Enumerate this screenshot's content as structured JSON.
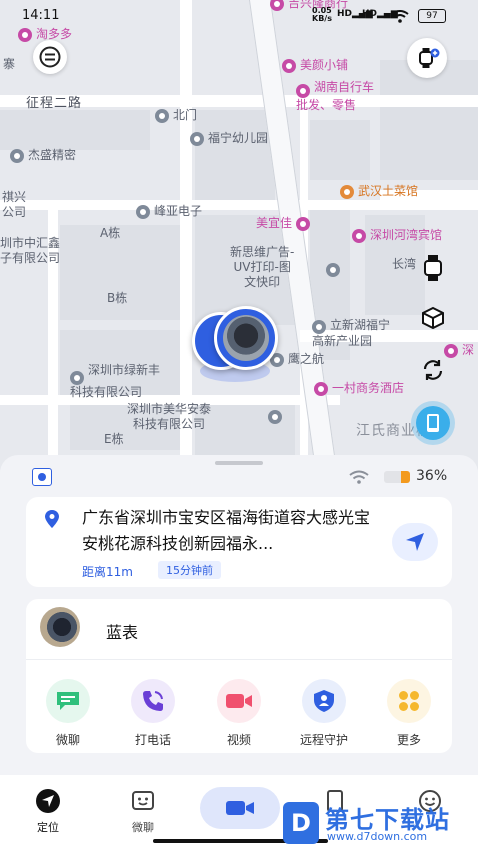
{
  "status_bar": {
    "time": "14:11",
    "net_speed_top": "0.05",
    "net_speed_unit": "KB/s",
    "signal1": "HD",
    "signal2": "HD",
    "battery": "97"
  },
  "map": {
    "pois": [
      {
        "id": "taoduoduo",
        "text": "淘多多",
        "color": "pink"
      },
      {
        "id": "zhengcheng-road",
        "text": "征程二路"
      },
      {
        "id": "beimen",
        "text": "北门"
      },
      {
        "id": "funing-kindergarten",
        "text": "福宁幼儿园"
      },
      {
        "id": "jiesheng",
        "text": "杰盛精密"
      },
      {
        "id": "qixing",
        "text": "祺兴\n公司"
      },
      {
        "id": "zhonghuixin",
        "text": "圳市中汇鑫\n子有限公司"
      },
      {
        "id": "fengya",
        "text": "峰亚电子"
      },
      {
        "id": "a-building",
        "text": "A栋"
      },
      {
        "id": "b-building",
        "text": "B栋"
      },
      {
        "id": "e-building",
        "text": "E栋"
      },
      {
        "id": "meiyijia",
        "text": "美宜佳"
      },
      {
        "id": "xinsiwei",
        "text": "新思维广告-\nUV打印-图\n文快印"
      },
      {
        "id": "lvxinfeng",
        "text": "深圳市绿新丰\n科技有限公司"
      },
      {
        "id": "meihuaan",
        "text": "深圳市美华安泰\n科技有限公司"
      },
      {
        "id": "yingzhihang",
        "text": "鹰之航"
      },
      {
        "id": "xinhuning",
        "text": "立新湖福宁\n高新产业园"
      },
      {
        "id": "yicun-hotel",
        "text": "一村商务酒店"
      },
      {
        "id": "jiangshi",
        "text": "江氏商业楼"
      },
      {
        "id": "meiyan",
        "text": "美颜小铺"
      },
      {
        "id": "hunan-bike",
        "text": "湖南自行车\n批发、零售"
      },
      {
        "id": "wuhan-restaurant",
        "text": "武汉土菜馆"
      },
      {
        "id": "hewan-hotel",
        "text": "深圳河湾宾馆"
      },
      {
        "id": "changwan",
        "text": "长湾"
      },
      {
        "id": "ji-xing",
        "text": "吉兴隆商行"
      },
      {
        "id": "shen",
        "text": "深"
      },
      {
        "id": "zhai",
        "text": "寨"
      }
    ]
  },
  "sheet": {
    "wifi_label": "wifi",
    "battery_percent": "36%",
    "address": "广东省深圳市宝安区福海街道容大感光宝安桃花源科技创新园福永...",
    "distance": "距离11m",
    "time_ago": "15分钟前",
    "device_name": "蓝表",
    "functions": [
      {
        "label": "微聊",
        "icon": "chat-icon",
        "color": "#2fc07c",
        "bg": "#e5f7ee"
      },
      {
        "label": "打电话",
        "icon": "phone-icon",
        "color": "#6a3fd6",
        "bg": "#efe9fb"
      },
      {
        "label": "视频",
        "icon": "video-icon",
        "color": "#f0506e",
        "bg": "#fdeaee"
      },
      {
        "label": "远程守护",
        "icon": "shield-icon",
        "color": "#2f5fe0",
        "bg": "#e8eefc"
      },
      {
        "label": "更多",
        "icon": "grid-icon",
        "color": "#f5b82e",
        "bg": "#fdf5e2"
      }
    ]
  },
  "nav": {
    "items": [
      {
        "label": "定位",
        "icon": "location-icon"
      },
      {
        "label": "微聊",
        "icon": "chat-face-icon"
      },
      {
        "label": "",
        "icon": "video-call-icon"
      },
      {
        "label": "",
        "icon": "phone-device-icon"
      },
      {
        "label": "",
        "icon": "smile-icon"
      }
    ]
  },
  "watermark": {
    "brand": "第七下载站",
    "url": "www.d7down.com"
  },
  "colors": {
    "accent": "#2f5fe0",
    "battery_orange": "#f39a1e",
    "map_bg": "#e7e9ee"
  }
}
